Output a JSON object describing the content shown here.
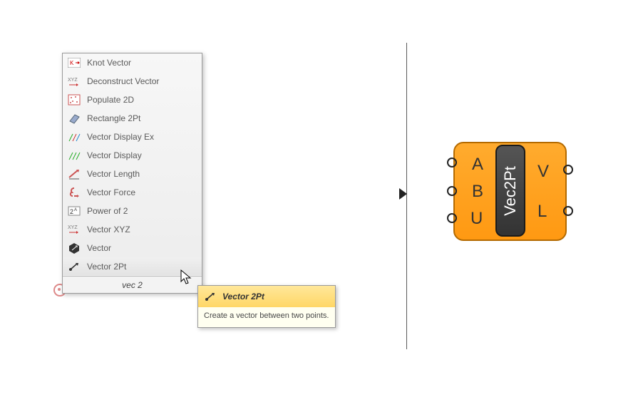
{
  "menu": {
    "items": [
      {
        "label": "Knot Vector"
      },
      {
        "label": "Deconstruct Vector"
      },
      {
        "label": "Populate 2D"
      },
      {
        "label": "Rectangle 2Pt"
      },
      {
        "label": "Vector Display Ex"
      },
      {
        "label": "Vector Display"
      },
      {
        "label": "Vector Length"
      },
      {
        "label": "Vector Force"
      },
      {
        "label": "Power of 2"
      },
      {
        "label": "Vector XYZ"
      },
      {
        "label": "Vector"
      },
      {
        "label": "Vector 2Pt"
      }
    ],
    "search": "vec 2"
  },
  "tooltip": {
    "title": "Vector 2Pt",
    "body": "Create a vector between two points."
  },
  "component": {
    "name": "Vec2Pt",
    "inputs": [
      "A",
      "B",
      "U"
    ],
    "outputs": [
      "V",
      "L"
    ]
  }
}
